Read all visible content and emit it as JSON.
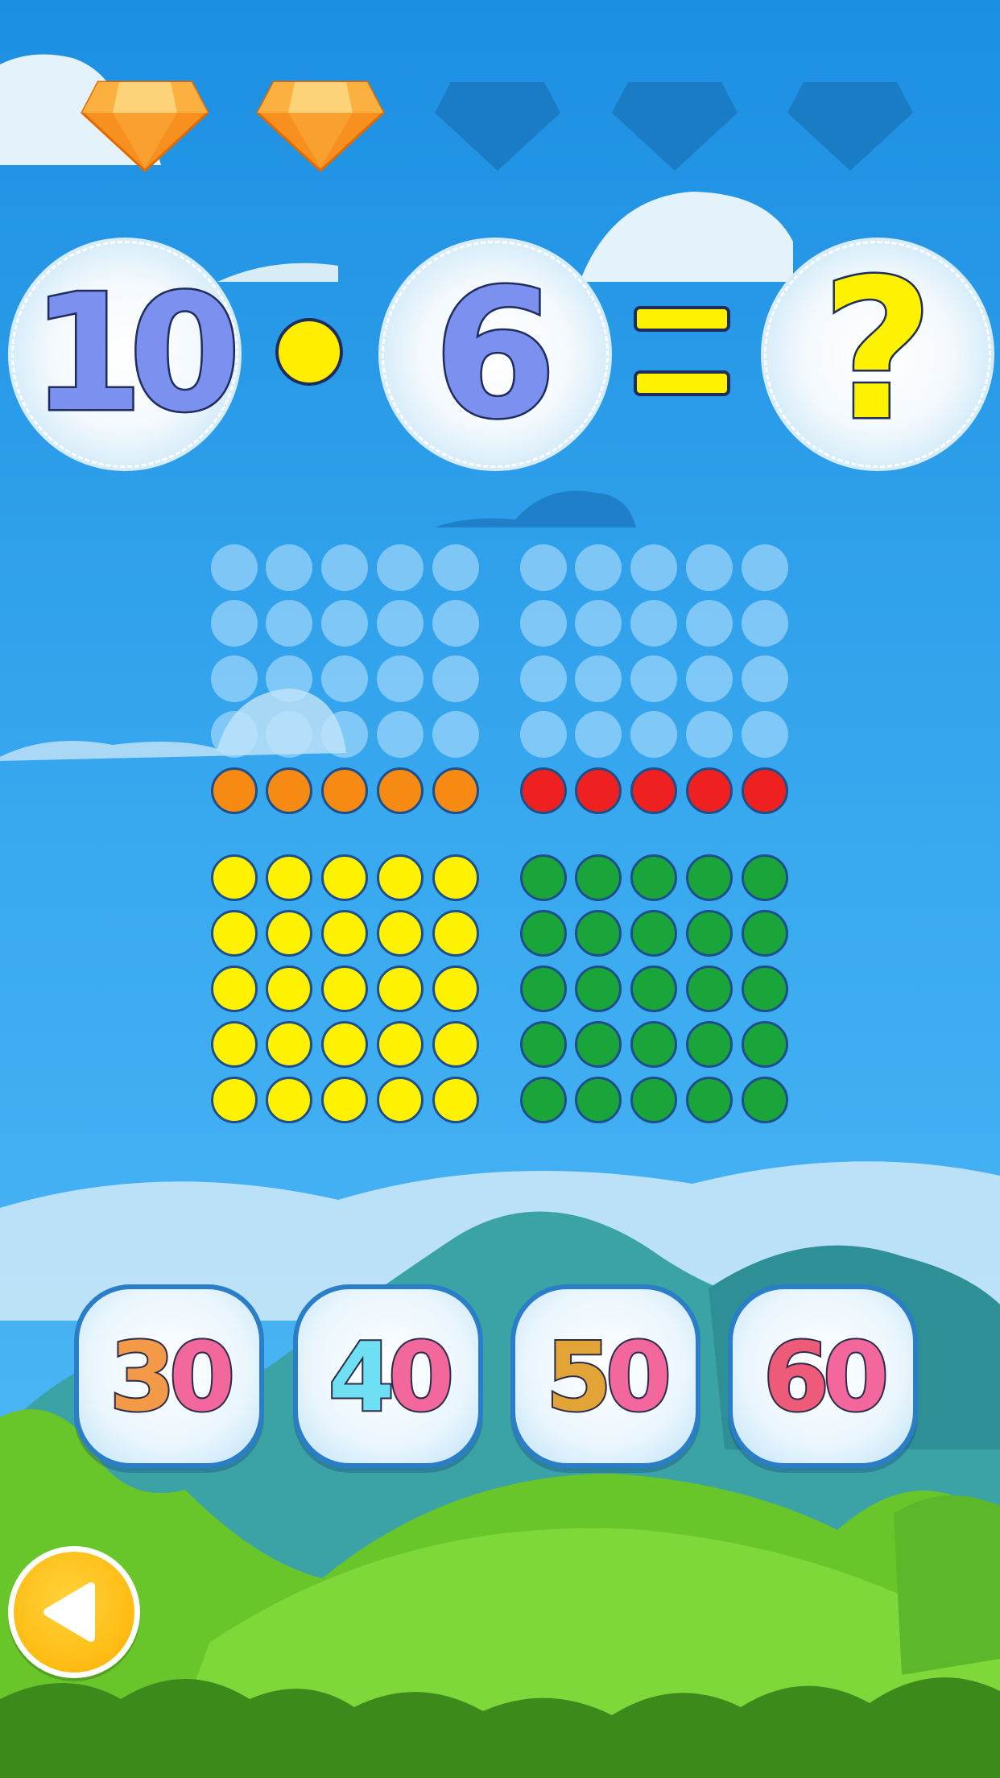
{
  "gems": [
    {
      "state": "earned",
      "color": "#f7901e"
    },
    {
      "state": "earned",
      "color": "#f7901e"
    },
    {
      "state": "empty",
      "color": "#1a7cc4"
    },
    {
      "state": "empty",
      "color": "#1a7cc4"
    },
    {
      "state": "empty",
      "color": "#1a7cc4"
    }
  ],
  "equation": {
    "left": "10",
    "operator": "•",
    "right": "6",
    "equals": "=",
    "result": "?"
  },
  "dot_grid": {
    "faint_rows": 4,
    "columns_per_block": 5,
    "blocks": [
      {
        "row_colors": [
          "orange",
          "yellow",
          "yellow",
          "yellow",
          "yellow",
          "yellow"
        ]
      },
      {
        "row_colors": [
          "red",
          "green",
          "green",
          "green",
          "green",
          "green"
        ]
      }
    ]
  },
  "answers": [
    {
      "label": "30",
      "tens_color": "#f29a48",
      "ones_color": "#f2679c"
    },
    {
      "label": "40",
      "tens_color": "#6fe0f4",
      "ones_color": "#f2679c"
    },
    {
      "label": "50",
      "tens_color": "#e3a437",
      "ones_color": "#f2679c"
    },
    {
      "label": "60",
      "tens_color": "#ee5b79",
      "ones_color": "#f2679c"
    }
  ],
  "back_button": {
    "icon": "back-arrow-icon"
  },
  "colors": {
    "sky": "#2b9de8",
    "hill_teal": "#3aa6a8",
    "grass": "#6ccb2a"
  }
}
